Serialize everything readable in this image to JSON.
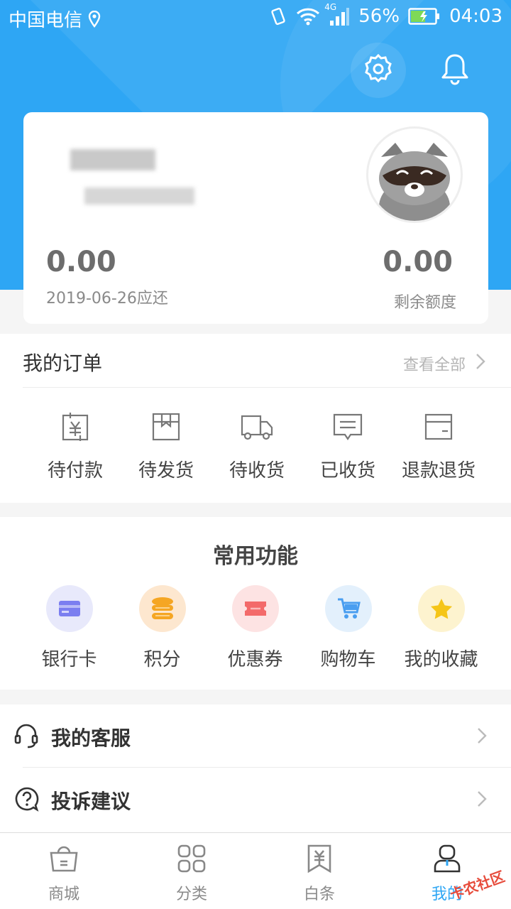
{
  "status_bar": {
    "carrier": "中国电信",
    "network": "4G",
    "battery": "56%",
    "time": "04:03"
  },
  "header": {
    "settings_icon": "gear-icon",
    "notification_icon": "bell-icon"
  },
  "account_card": {
    "due_amount": "0.00",
    "due_date_label": "2019-06-26应还",
    "remaining_amount": "0.00",
    "remaining_label": "剩余额度"
  },
  "orders": {
    "title": "我的订单",
    "view_all": "查看全部",
    "items": [
      {
        "label": "待付款",
        "icon": "payment-pending-icon"
      },
      {
        "label": "待发货",
        "icon": "package-icon"
      },
      {
        "label": "待收货",
        "icon": "truck-icon"
      },
      {
        "label": "已收货",
        "icon": "message-icon"
      },
      {
        "label": "退款退货",
        "icon": "refund-card-icon"
      }
    ]
  },
  "common_functions": {
    "title": "常用功能",
    "items": [
      {
        "label": "银行卡",
        "icon": "bank-card-icon",
        "bg": "#e8e9fb",
        "color": "#7b7ef0"
      },
      {
        "label": "积分",
        "icon": "coins-icon",
        "bg": "#fde7cf",
        "color": "#f5a623"
      },
      {
        "label": "优惠券",
        "icon": "coupon-icon",
        "bg": "#fde3e3",
        "color": "#f36a6a"
      },
      {
        "label": "购物车",
        "icon": "cart-icon",
        "bg": "#e3f0fc",
        "color": "#4a9ef0"
      },
      {
        "label": "我的收藏",
        "icon": "star-icon",
        "bg": "#fdf3cf",
        "color": "#f5c518"
      }
    ]
  },
  "services": [
    {
      "label": "我的客服",
      "icon": "headset-icon"
    },
    {
      "label": "投诉建议",
      "icon": "question-icon"
    }
  ],
  "tabbar": [
    {
      "label": "商城",
      "icon": "shop-bag-icon",
      "active": false
    },
    {
      "label": "分类",
      "icon": "grid-icon",
      "active": false
    },
    {
      "label": "白条",
      "icon": "yen-bookmark-icon",
      "active": false
    },
    {
      "label": "我的",
      "icon": "user-icon",
      "active": true
    }
  ],
  "watermark": "卡农社区",
  "colors": {
    "primary": "#2ea6f4",
    "text": "#444444",
    "muted": "#8a8a8a"
  }
}
